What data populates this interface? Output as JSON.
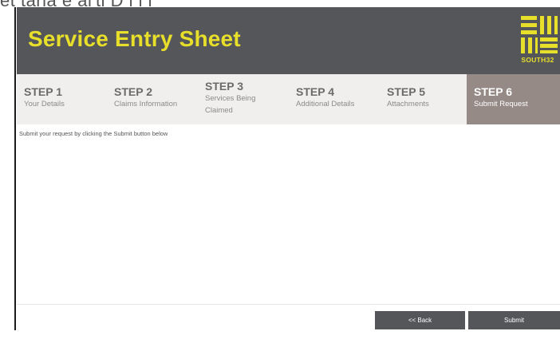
{
  "background_text": "et                              tariá    e al'ti           D                  l        l l",
  "header": {
    "title": "Service Entry Sheet",
    "logo_text": "SOUTH32",
    "background_color": "#54565a",
    "title_color": "#e8df2a"
  },
  "steps": [
    {
      "number": "STEP 1",
      "label": "Your Details",
      "active": false
    },
    {
      "number": "STEP 2",
      "label": "Claims Information",
      "active": false
    },
    {
      "number": "STEP 3",
      "label": "Services Being Claimed",
      "active": false
    },
    {
      "number": "STEP 4",
      "label": "Additional Details",
      "active": false
    },
    {
      "number": "STEP 5",
      "label": "Attachments",
      "active": false
    },
    {
      "number": "STEP 6",
      "label": "Submit Request",
      "active": true
    }
  ],
  "steps_active_color": "#968a86",
  "content": {
    "instruction": "Submit your request by clicking the Submit button below"
  },
  "buttons": {
    "back_label": "<< Back",
    "submit_label": "Submit"
  }
}
